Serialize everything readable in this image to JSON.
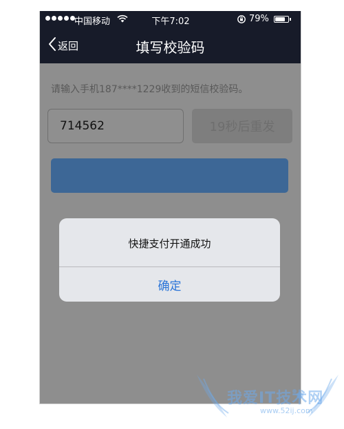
{
  "status_bar": {
    "carrier": "中国移动",
    "time": "下午7:02",
    "battery_percent": "79%",
    "battery_level": 0.79,
    "signal_bars": 5
  },
  "nav": {
    "back_label": "返回",
    "title": "填写校验码"
  },
  "form": {
    "hint": "请输入手机187****1229收到的短信校验码。",
    "code_value": "714562",
    "resend_label": "19秒后重发"
  },
  "alert": {
    "message": "快捷支付开通成功",
    "confirm_label": "确定"
  },
  "watermark": {
    "text": "我爱IT技术网",
    "url": "www.52ij.com"
  },
  "colors": {
    "nav_bg": "#171b29",
    "overlay_gray": "#8e8e8e",
    "primary_button": "#3d6796",
    "alert_button_text": "#2a74d8"
  },
  "icons": {
    "back": "chevron-left-icon",
    "wifi": "wifi-icon",
    "rotation_lock": "rotation-lock-icon",
    "battery": "battery-icon"
  }
}
